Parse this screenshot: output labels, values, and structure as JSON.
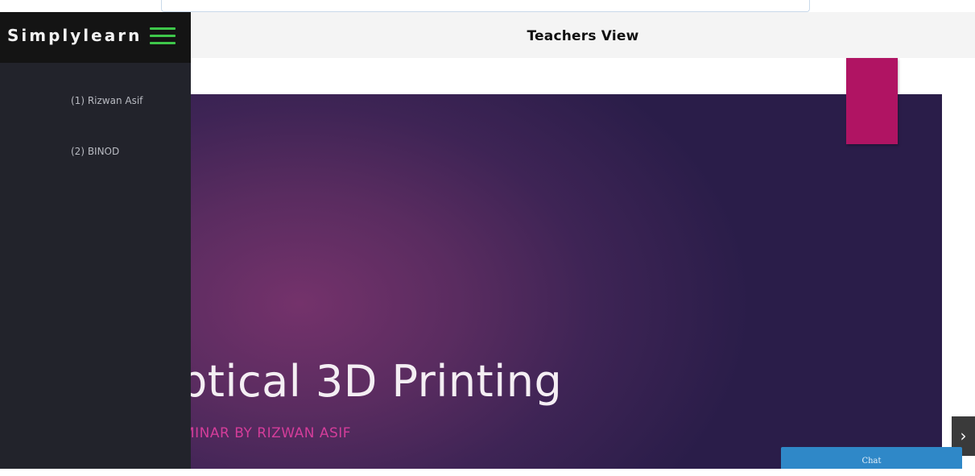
{
  "brand": {
    "name": "Simplylearn",
    "menu_icon": "hamburger-menu-icon",
    "accent_color": "#3ec74a"
  },
  "header": {
    "title": "Teachers View"
  },
  "sidebar": {
    "items": [
      {
        "label": "(1) Rizwan Asif"
      },
      {
        "label": "(2) BINOD"
      }
    ]
  },
  "slide": {
    "title": "ptical 3D Printing",
    "subtitle": "MINAR BY RIZWAN ASIF",
    "accent_color": "#b01463"
  },
  "controls": {
    "next_icon": "chevron-right-icon",
    "next_glyph": "›",
    "chat_label": "Chat"
  }
}
